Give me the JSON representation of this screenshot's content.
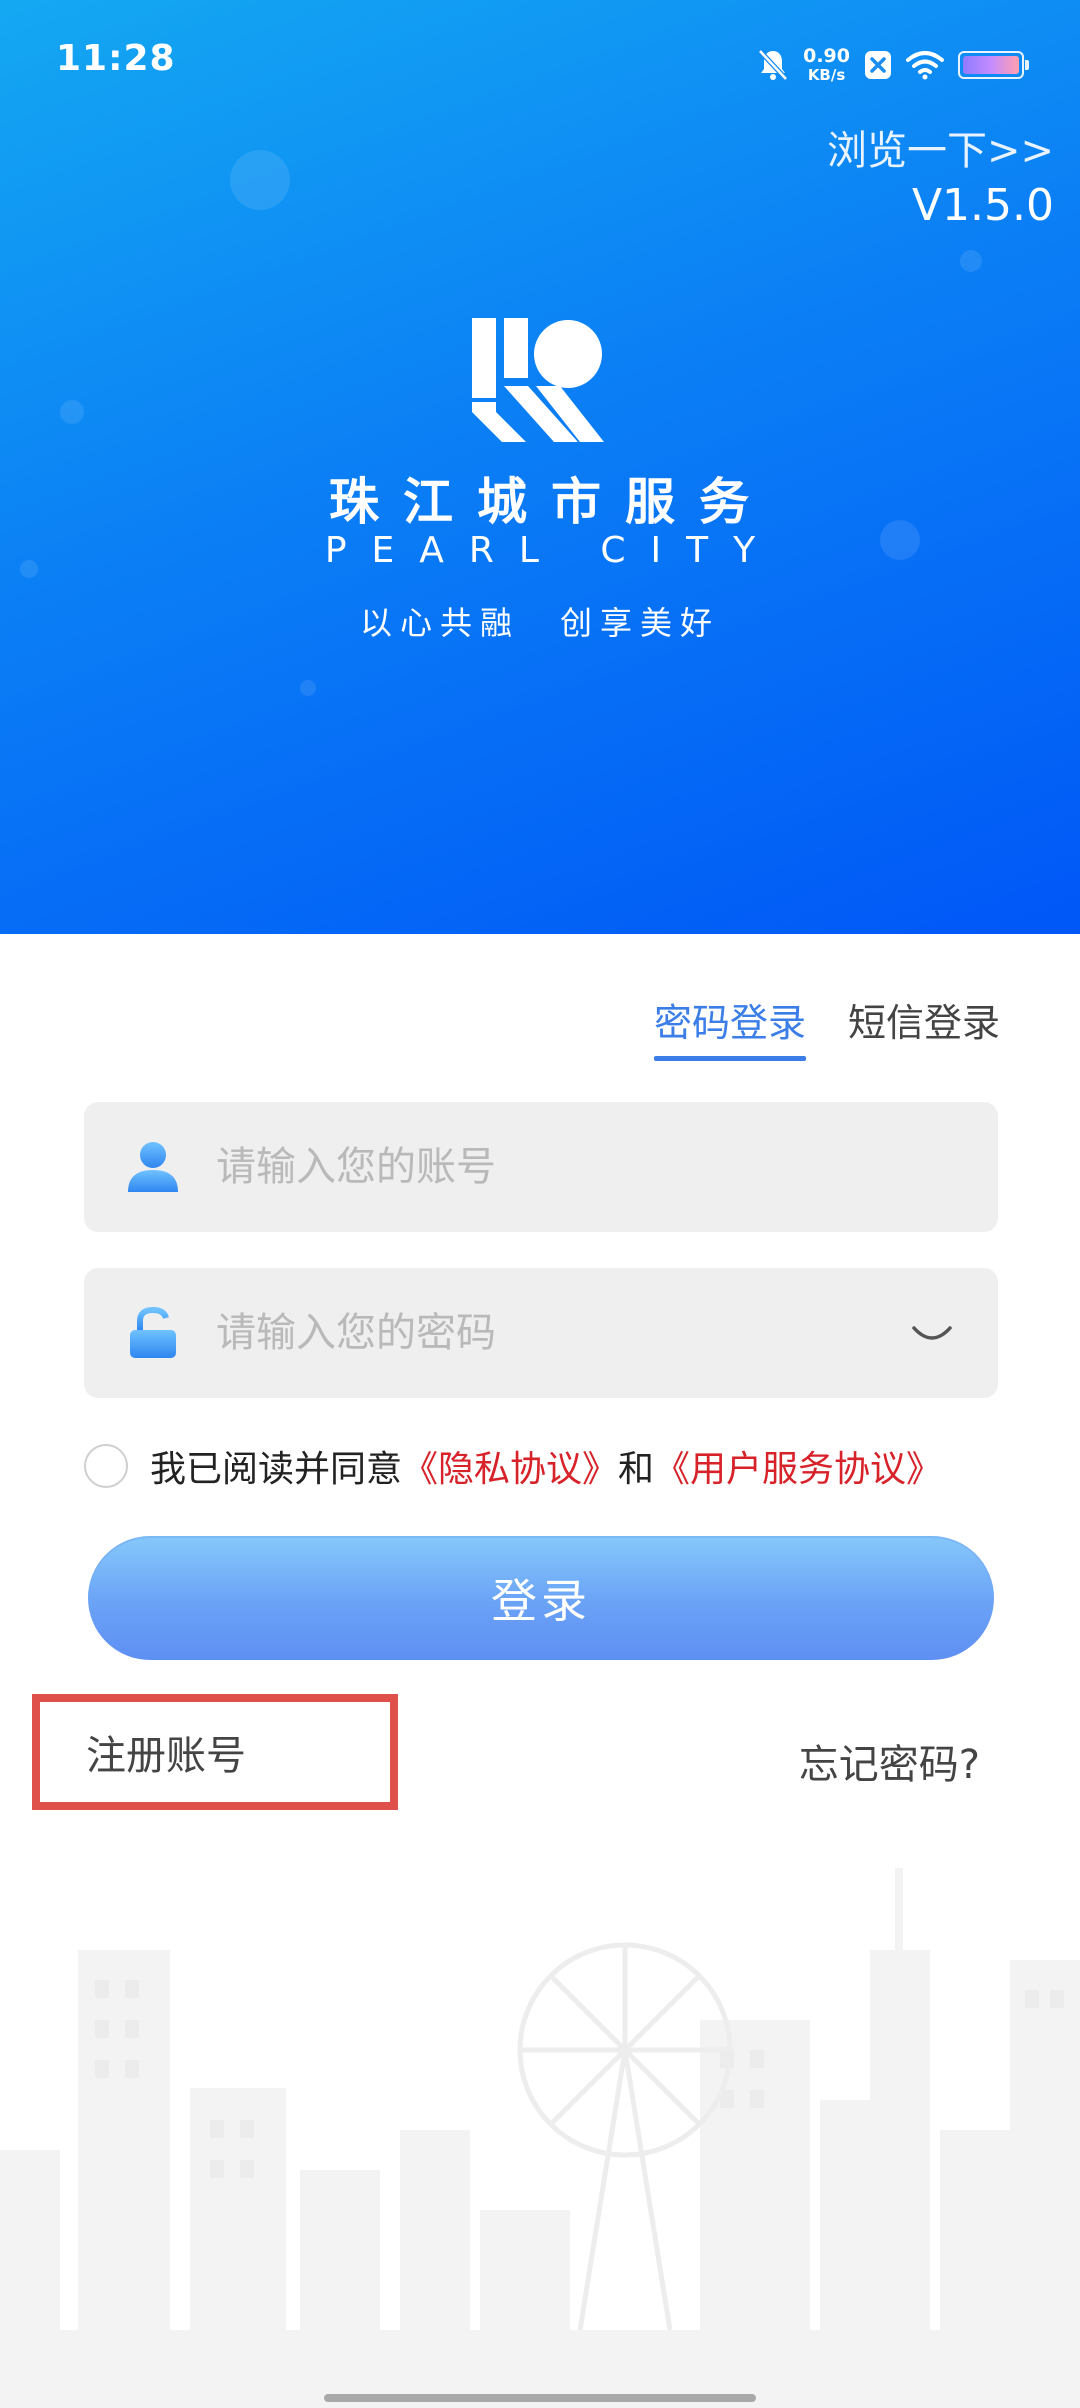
{
  "status_bar": {
    "time": "11:28",
    "speed_value": "0.90",
    "speed_unit": "KB/s",
    "icons": [
      "bell-muted-icon",
      "x-badge-icon",
      "wifi-icon",
      "battery-icon"
    ]
  },
  "header": {
    "browse_link": "浏览一下>>",
    "version": "V1.5.0",
    "brand_cn": "珠江城市服务",
    "brand_en": "PEARL CITY",
    "slogan": "以心共融　创享美好"
  },
  "tabs": [
    {
      "label": "密码登录",
      "active": true
    },
    {
      "label": "短信登录",
      "active": false
    }
  ],
  "form": {
    "account_placeholder": "请输入您的账号",
    "account_value": "",
    "password_placeholder": "请输入您的密码",
    "password_value": ""
  },
  "agreement": {
    "prefix": "我已阅读并同意",
    "privacy_link": "《隐私协议》",
    "and": "和",
    "service_link": "《用户服务协议》",
    "checked": false
  },
  "login_button": "登录",
  "register_link": "注册账号",
  "forgot_link": "忘记密码?",
  "colors": {
    "hero_gradient_start": "#14a8f2",
    "hero_gradient_end": "#0057f7",
    "tab_active": "#3b7ee8",
    "link_red": "#d8222a",
    "button_start": "#86c8fb",
    "button_end": "#5e8ff3",
    "highlight_box": "#e0504a"
  }
}
